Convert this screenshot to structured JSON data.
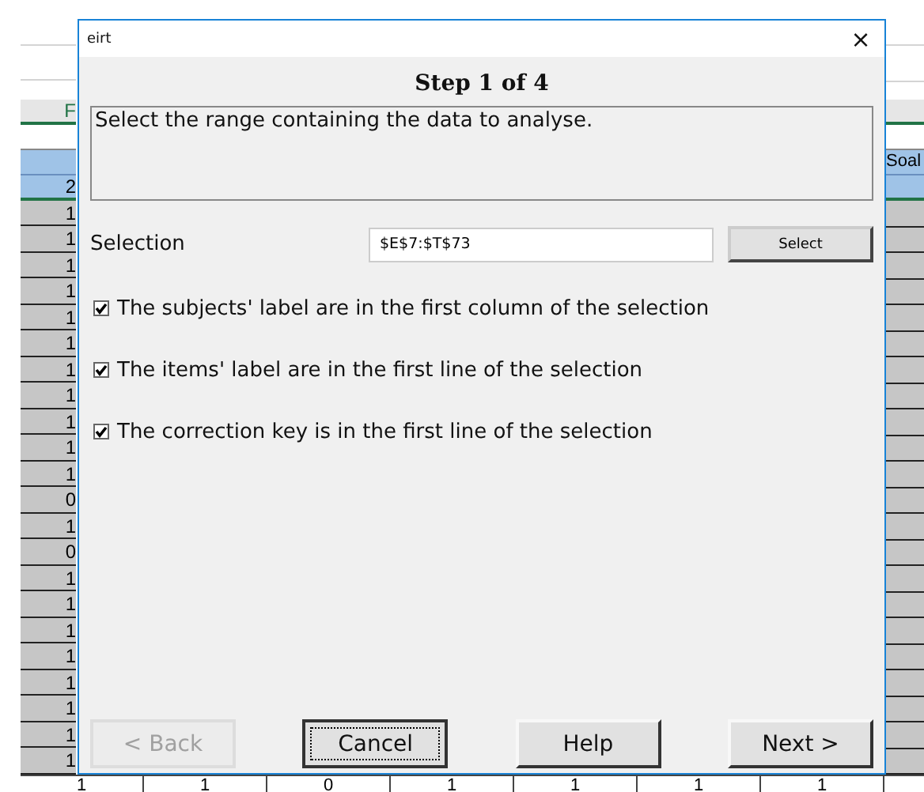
{
  "sheet": {
    "column_header": "F",
    "right_header": "Soal",
    "left_cells": [
      "2",
      "1",
      "1",
      "1",
      "1",
      "1",
      "1",
      "1",
      "1",
      "1",
      "1",
      "1",
      "0",
      "1",
      "0",
      "1",
      "1",
      "1",
      "1",
      "1",
      "1",
      "1",
      "1"
    ],
    "bottom_row": [
      "1",
      "1",
      "0",
      "1",
      "1",
      "1",
      "1"
    ]
  },
  "dialog": {
    "title": "eirt",
    "close": "×",
    "step": "Step 1 of 4",
    "instructions": "Select the range containing the data to analyse.",
    "selection": {
      "label": "Selection",
      "value": "$E$7:$T$73",
      "button": "Select"
    },
    "options": [
      {
        "label": "The subjects' label are in the first column of the selection",
        "checked": true
      },
      {
        "label": "The items' label are in the first line of the selection",
        "checked": true
      },
      {
        "label": "The correction key is in the first line of the selection",
        "checked": true
      }
    ],
    "buttons": [
      {
        "label": "< Back",
        "disabled": true,
        "focused": false
      },
      {
        "label": "Cancel",
        "disabled": false,
        "focused": true
      },
      {
        "label": "Help",
        "disabled": false,
        "focused": false
      },
      {
        "label": "Next >",
        "disabled": false,
        "focused": false
      }
    ]
  }
}
